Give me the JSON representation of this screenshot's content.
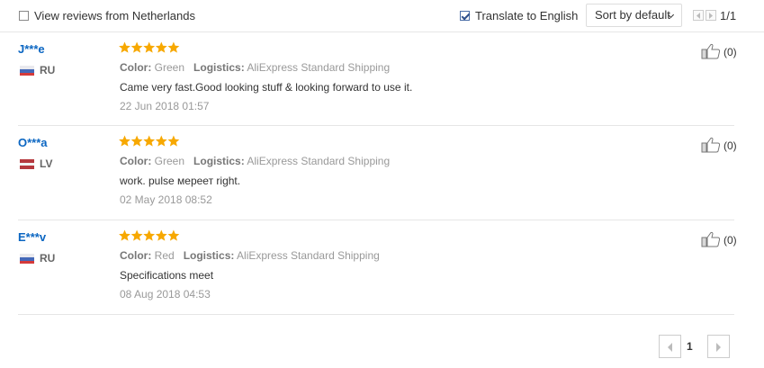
{
  "toolbar": {
    "view_reviews_label": "View reviews from Netherlands",
    "view_reviews_checked": false,
    "translate_label": "Translate to English",
    "translate_checked": true,
    "sort_label": "Sort by default",
    "page_indicator": "1/1"
  },
  "review_labels": {
    "color": "Color:",
    "logistics": "Logistics:"
  },
  "reviews": [
    {
      "name": "J***e",
      "country": "RU",
      "rating": 5,
      "color": "Green",
      "logistics": "AliExpress Standard Shipping",
      "text": "Came very fast.Good looking stuff & looking forward to use it.",
      "date": "22 Jun 2018 01:57",
      "likes": "(0)"
    },
    {
      "name": "O***a",
      "country": "LV",
      "rating": 5,
      "color": "Green",
      "logistics": "AliExpress Standard Shipping",
      "text": "work. pulse мереет right.",
      "date": "02 May 2018 08:52",
      "likes": "(0)"
    },
    {
      "name": "E***v",
      "country": "RU",
      "rating": 5,
      "color": "Red",
      "logistics": "AliExpress Standard Shipping",
      "text": "Specifications meet",
      "date": "08 Aug 2018 04:53",
      "likes": "(0)"
    }
  ],
  "pagination": {
    "current_page": "1"
  },
  "colors": {
    "star": "#f7a800",
    "name_link": "#0b66c2",
    "divider": "#e6e6e6"
  },
  "icons": {
    "star": "star-icon",
    "thumbs_up": "thumbs-up-icon",
    "flag_ru": "flag-ru-icon",
    "flag_lv": "flag-lv-icon"
  }
}
